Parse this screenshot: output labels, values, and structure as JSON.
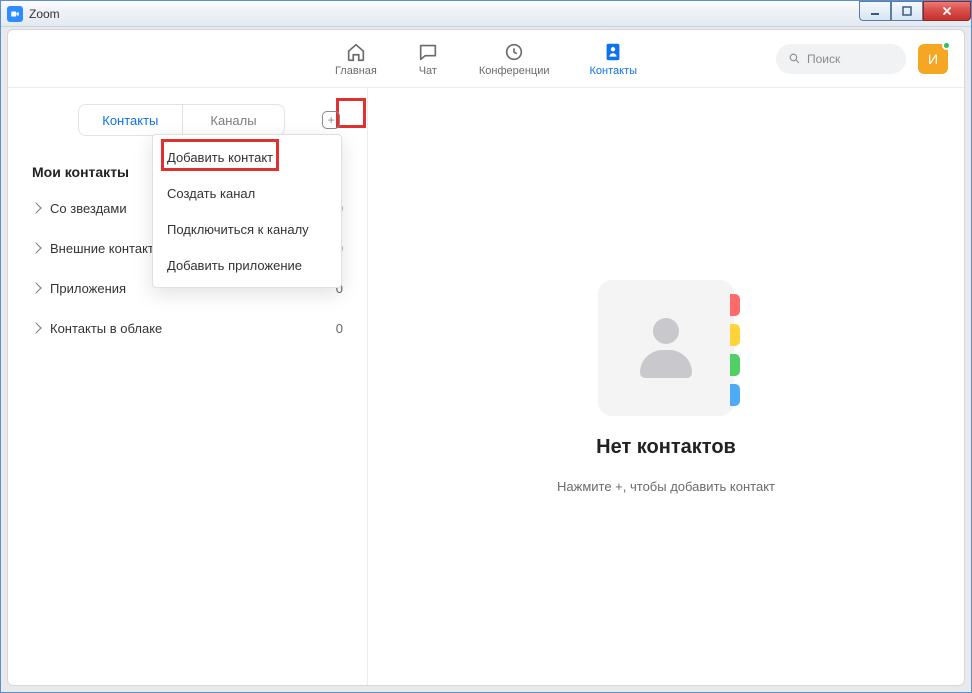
{
  "window": {
    "title": "Zoom"
  },
  "nav": {
    "items": [
      {
        "label": "Главная"
      },
      {
        "label": "Чат"
      },
      {
        "label": "Конференции"
      },
      {
        "label": "Контакты"
      }
    ],
    "search_placeholder": "Поиск",
    "avatar_initial": "И"
  },
  "sidebar": {
    "tabs": [
      {
        "label": "Контакты"
      },
      {
        "label": "Каналы"
      }
    ],
    "section_title": "Мои контакты",
    "categories": [
      {
        "label": "Со звездами",
        "count": "0"
      },
      {
        "label": "Внешние контакты",
        "count": "0"
      },
      {
        "label": "Приложения",
        "count": "0"
      },
      {
        "label": "Контакты в облаке",
        "count": "0"
      }
    ]
  },
  "dropdown": {
    "items": [
      {
        "label": "Добавить контакт"
      },
      {
        "label": "Создать канал"
      },
      {
        "label": "Подключиться к каналу"
      },
      {
        "label": "Добавить приложение"
      }
    ]
  },
  "empty": {
    "title": "Нет контактов",
    "subtitle": "Нажмите +, чтобы добавить контакт"
  }
}
